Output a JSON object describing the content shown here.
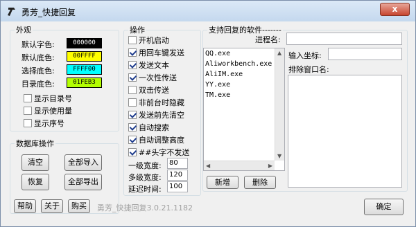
{
  "window": {
    "title": "勇芳_快捷回复",
    "close_label": "x"
  },
  "appearance": {
    "legend": "外观",
    "rows": [
      {
        "label": "默认字色:",
        "value": "000000",
        "bg": "#000000",
        "fg": "#ffffff"
      },
      {
        "label": "默认底色:",
        "value": "00FFFF",
        "bg": "#ffff00",
        "fg": "#000000"
      },
      {
        "label": "选择底色:",
        "value": "FFFF00",
        "bg": "#00ffff",
        "fg": "#000000"
      },
      {
        "label": "目录底色:",
        "value": "01FEB3",
        "bg": "#b3fe01",
        "fg": "#000000"
      }
    ],
    "options": [
      {
        "label": "显示目录号",
        "checked": false
      },
      {
        "label": "显示使用量",
        "checked": false
      },
      {
        "label": "显示序号",
        "checked": false
      }
    ]
  },
  "database": {
    "legend": "数据库操作",
    "clear": "清空",
    "import_all": "全部导入",
    "restore": "恢复",
    "export_all": "全部导出"
  },
  "operations": {
    "legend": "操作",
    "options": [
      {
        "label": "开机启动",
        "checked": false
      },
      {
        "label": "用回车键发送",
        "checked": true
      },
      {
        "label": "发送文本",
        "checked": true
      },
      {
        "label": "一次性传送",
        "checked": true
      },
      {
        "label": "双击传送",
        "checked": false
      },
      {
        "label": "非前台时隐藏",
        "checked": false
      },
      {
        "label": "发送前先清空",
        "checked": true
      },
      {
        "label": "自动搜索",
        "checked": true
      },
      {
        "label": "自动调整高度",
        "checked": true
      },
      {
        "label": "##头字不发送",
        "checked": true
      }
    ],
    "level1_label": "一级宽度:",
    "level1_value": "80",
    "multilevel_label": "多级宽度:",
    "multilevel_value": "120",
    "delay_label": "延迟时间:",
    "delay_value": "100"
  },
  "software": {
    "legend": "支持回复的软件-------",
    "process_label": "进程名:",
    "process_value": "",
    "items": [
      "QQ.exe",
      "Aliworkbench.exe",
      "AliIM.exe",
      "YY.exe",
      "TM.exe"
    ],
    "add": "新增",
    "delete": "删除",
    "coord_label": "输入坐标:",
    "coord_value": "",
    "exclude_label": "排除窗口名:"
  },
  "footer": {
    "help": "帮助",
    "about": "关于",
    "buy": "购买",
    "version": "勇芳_快捷回复3.0.21.1182",
    "ok": "确定"
  }
}
